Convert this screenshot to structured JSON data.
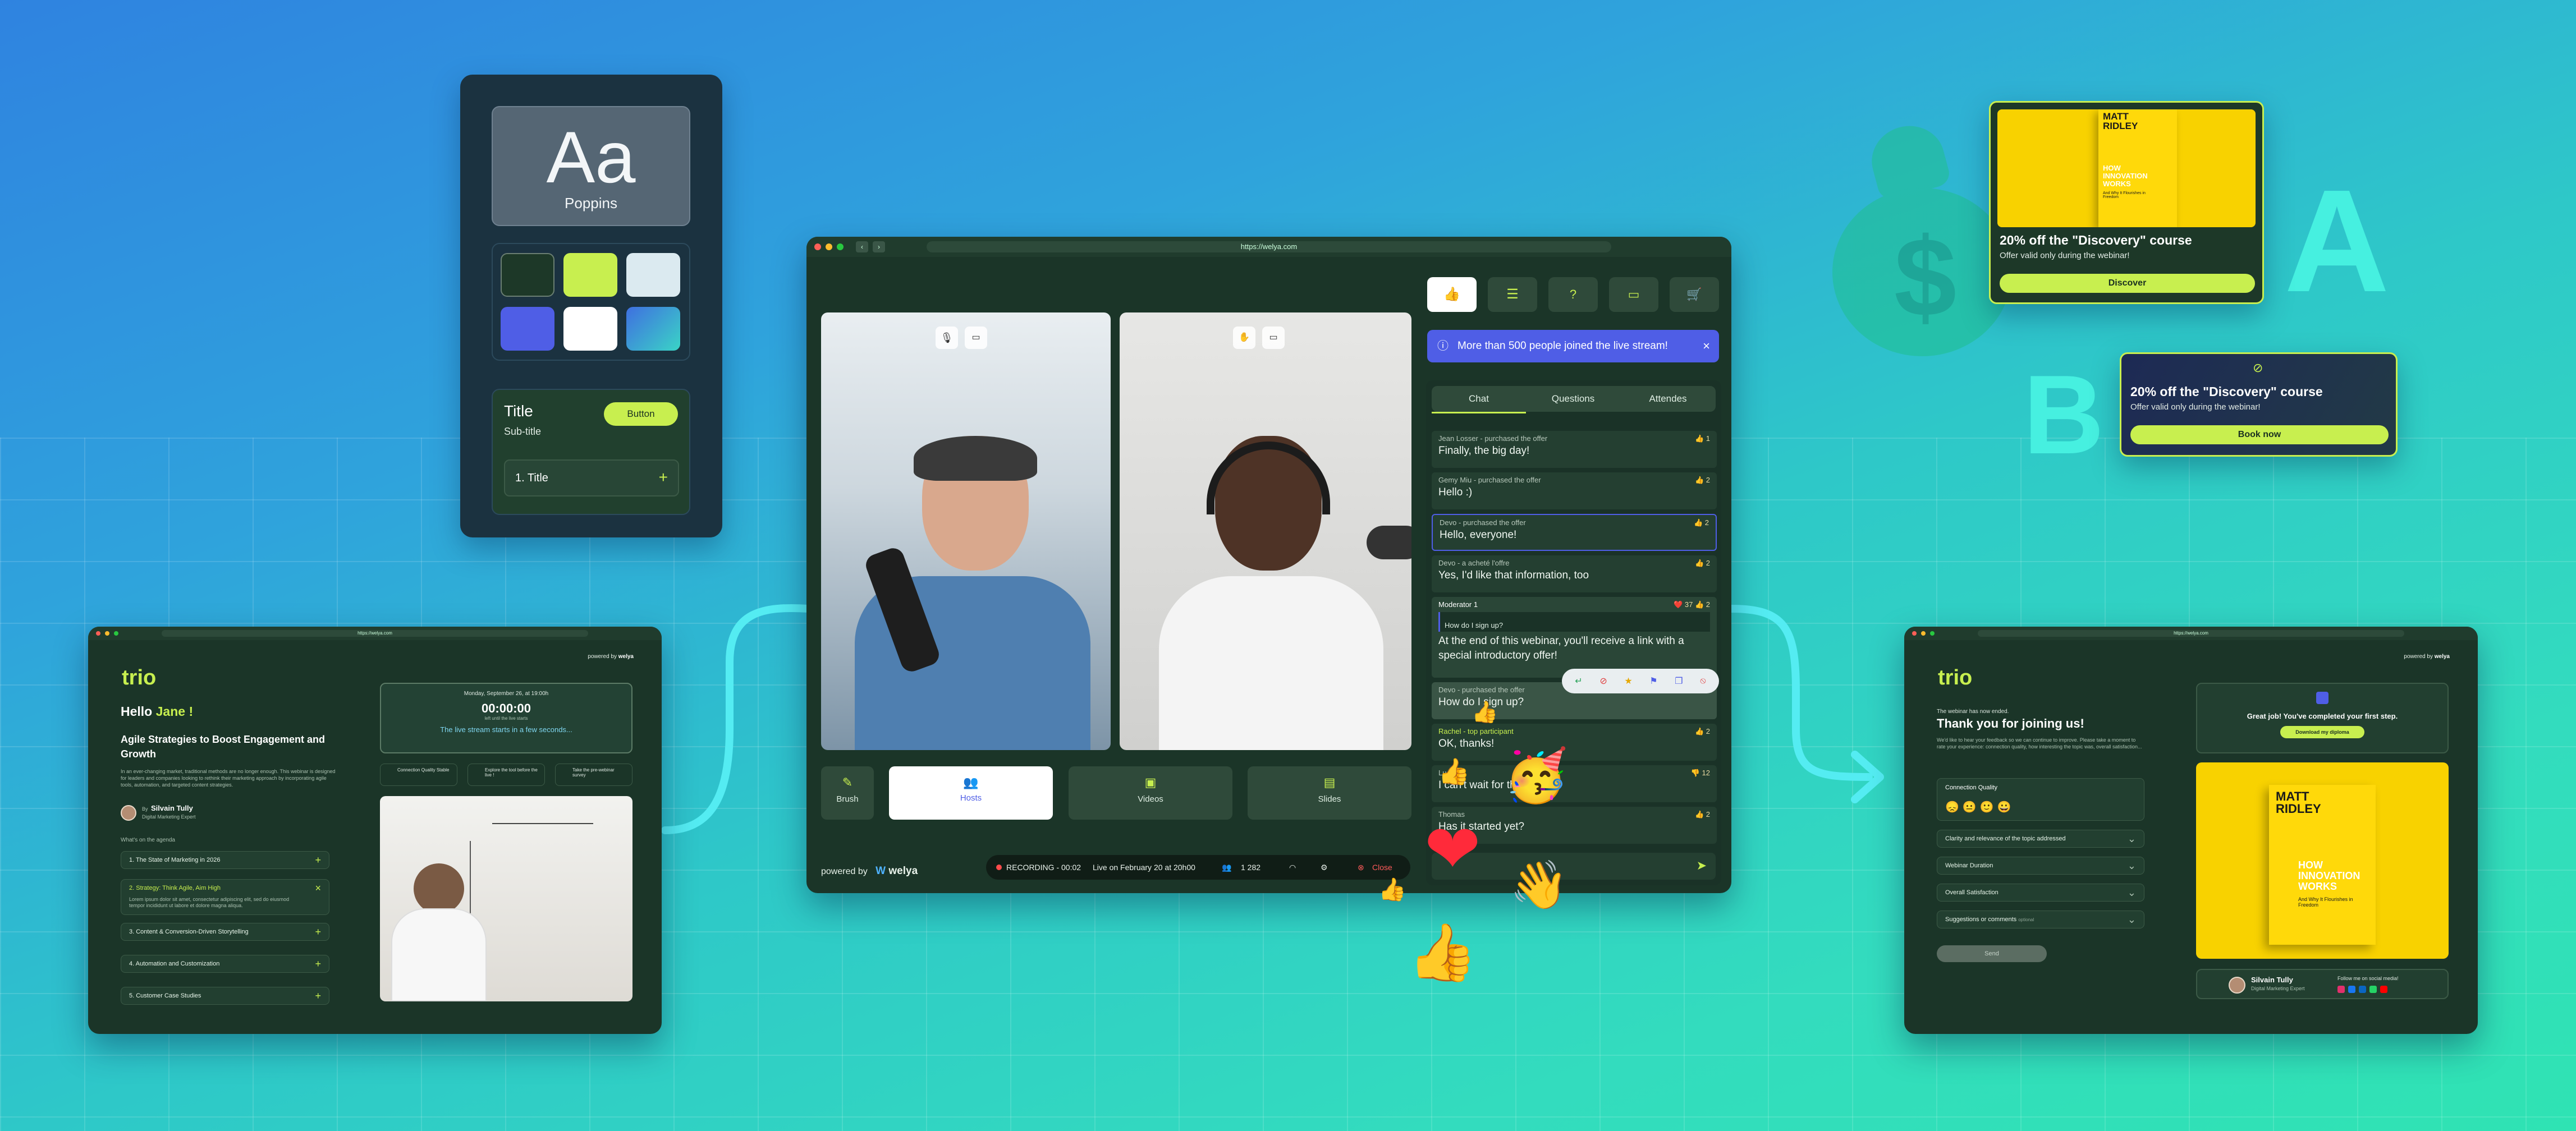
{
  "typography": {
    "sample": "Aa",
    "font_name": "Poppins"
  },
  "palette": [
    "#1d3828",
    "#c8ef4f",
    "#dbeaf0",
    "#4f5ee6",
    "#ffffff",
    "#3bb3d8"
  ],
  "component_preview": {
    "title": "Title",
    "subtitle": "Sub-title",
    "button": "Button",
    "item": "1. Title"
  },
  "main": {
    "url": "https://welya.com",
    "toolbar": [
      "like-icon",
      "list-icon",
      "question-icon",
      "folder-icon",
      "cart-icon"
    ],
    "notice": "More than 500 people joined the live stream!",
    "tabs": [
      "Chat",
      "Questions",
      "Attendes"
    ],
    "chat": [
      {
        "author": "Jean Losser - purchased the offer",
        "text": "Finally, the big day!",
        "reactions": "👍 1"
      },
      {
        "author": "Gemy Miu - purchased the offer",
        "text": "Hello :)",
        "reactions": "👍 2"
      },
      {
        "author": "Devo - purchased the offer",
        "text": "Hello, everyone!",
        "reactions": "👍 2"
      },
      {
        "author": "Devo - a acheté l'offre",
        "text": "Yes, I'd like that information, too",
        "reactions": "👍 2"
      },
      {
        "author": "Moderator 1",
        "quote": "How do I sign up?",
        "text": "At the end of this webinar, you'll receive a link with a special introductory offer!",
        "reactions": "❤️ 37  👍 2"
      },
      {
        "author": "Devo - purchased the offer",
        "text": "How do I sign up?",
        "reactions": ""
      },
      {
        "author": "Rachel - top participant",
        "text": "OK, thanks!",
        "reactions": "👍 2"
      },
      {
        "author": "Lu",
        "text": "I can't wait for the demo",
        "reactions": "👎 12"
      },
      {
        "author": "Thomas",
        "text": "Has it started yet?",
        "reactions": "👍 2"
      }
    ],
    "controls": {
      "brush": "Brush",
      "hosts": "Hosts",
      "videos": "Videos",
      "slides": "Slides"
    },
    "powered_by": "powered by",
    "brand": "welya",
    "status": {
      "recording": "RECORDING - 00:02",
      "live": "Live on February 20 at 20h00",
      "viewers": "1 282",
      "close": "Close"
    }
  },
  "promo_a": {
    "book_author": "MATT RIDLEY",
    "book_title": "HOW INNOVATION WORKS",
    "book_sub": "And Why It Flourishes in Freedom",
    "title": "20% off the \"Discovery\" course",
    "subtitle": "Offer valid only during the webinar!",
    "button": "Discover",
    "label": "A"
  },
  "promo_b": {
    "title": "20% off the \"Discovery\" course",
    "subtitle": "Offer valid only during the webinar!",
    "button": "Book now",
    "label": "B"
  },
  "registration": {
    "url": "https://welya.com",
    "powered": "powered by",
    "brand": "welya",
    "logo": "trio",
    "hello": "Hello",
    "name": "Jane !",
    "headline": "Agile Strategies to Boost Engagement and Growth",
    "body": "In an ever-changing market, traditional methods are no longer enough. This webinar is designed for leaders and companies looking to rethink their marketing approach by incorporating agile tools, automation, and targeted content strategies.",
    "author_by": "By",
    "author": "Silvain Tully",
    "author_role": "Digital Marketing Expert",
    "agenda_label": "What's on the agenda",
    "agenda": [
      "1. The State of Marketing in 2026",
      "2. Strategy: Think Agile, Aim High",
      "3. Content & Conversion-Driven Storytelling",
      "4. Automation and Customization",
      "5. Customer Case Studies"
    ],
    "agenda_detail": "Lorem ipsum dolor sit amet, consectetur adipiscing elit, sed do eiusmod tempor incididunt ut labore et dolore magna aliqua.",
    "date": "Monday, September 26, at 19:00h",
    "countdown": "00:00:00",
    "countdown_sub": "left until the live starts",
    "soon": "The live stream starts in a few seconds...",
    "checks": [
      "Connection Quality Stable",
      "Explore the tool before the live !",
      "Take the pre-webinar survey"
    ]
  },
  "thanks": {
    "url": "https://welya.com",
    "powered": "powered by",
    "brand": "welya",
    "logo": "trio",
    "ended": "The webinar has now ended.",
    "title": "Thank you for joining us!",
    "body": "We'd like to hear your feedback so we can continue to improve. Please take a moment to rate your experience: connection quality, how interesting the topic was, overall satisfaction...",
    "questions": [
      "Connection Quality",
      "Clarity and relevance of the topic addressed",
      "Webinar Duration",
      "Overall Satisfaction",
      "Suggestions or comments"
    ],
    "optional": "optional",
    "send": "Send",
    "great": "Great job! You've completed your first step.",
    "download": "Download my diploma",
    "author": "Silvain Tully",
    "author_role": "Digital Marketing Expert",
    "follow": "Follow me on social media!",
    "book_author": "MATT RIDLEY",
    "book_title": "HOW INNOVATION WORKS",
    "book_sub": "And Why It Flourishes in Freedom"
  }
}
